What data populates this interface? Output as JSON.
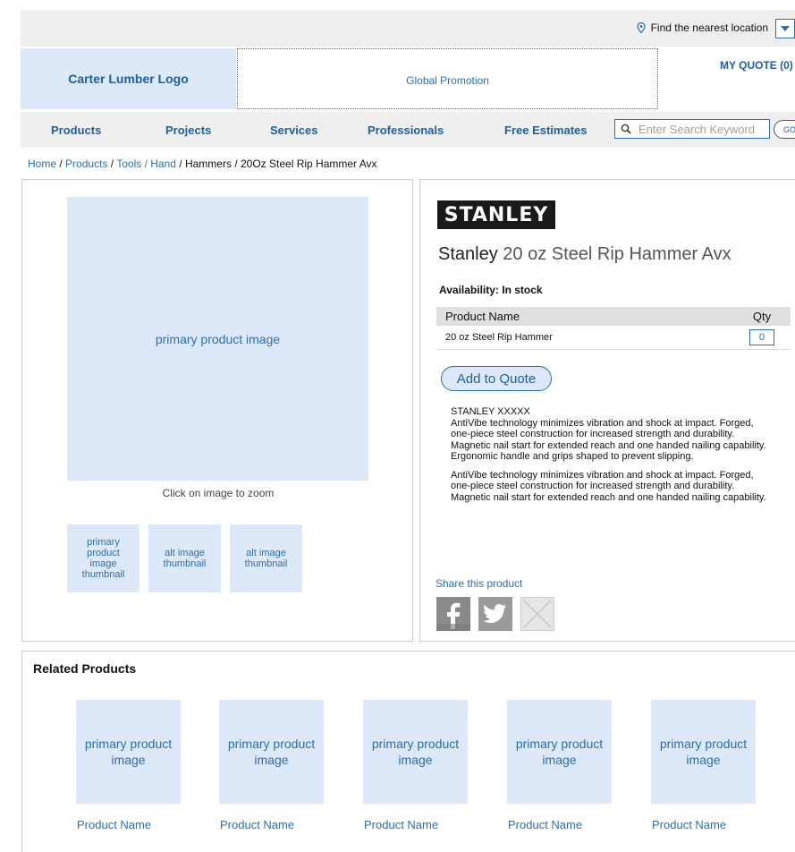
{
  "header": {
    "find_location": "Find the nearest location",
    "logo_text": "Carter Lumber Logo",
    "promotion": "Global Promotion",
    "my_quote": "MY QUOTE (0)"
  },
  "nav": {
    "items": [
      "Products",
      "Projects",
      "Services",
      "Professionals",
      "Free Estimates"
    ],
    "search_placeholder": "Enter Search Keyword",
    "go_label": "GO"
  },
  "breadcrumb": {
    "home": "Home",
    "sep": "/",
    "products": "Products",
    "tools_hand": "Tools / Hand",
    "hammers": "Hammers",
    "current": "20Oz Steel Rip Hammer Avx"
  },
  "gallery": {
    "primary_image": "primary product image",
    "zoom_note": "Click on image to zoom",
    "thumbnails": [
      "primary product image thumbnail",
      "alt image thumbnail",
      "alt image thumbnail"
    ]
  },
  "product": {
    "brand_logo": "STANLEY",
    "brand": "Stanley",
    "title_rest": "20 oz Steel Rip Hammer Avx",
    "availability": "Availability: In stock",
    "table_headers": [
      "Product Name",
      "Qty"
    ],
    "rows": [
      {
        "name": "20 oz Steel Rip Hammer",
        "qty": "0"
      }
    ],
    "add_to_quote": "Add to Quote",
    "desc_heading": "STANLEY XXXXX",
    "desc_p1": "AntiVibe technology minimizes vibration and shock at impact. Forged, one-piece steel construction for increased strength and durability. Magnetic nail start for extended reach and one handed nailing capability. Ergonomic handle and grips shaped to prevent slipping.",
    "desc_p2": "AntiVibe technology minimizes vibration and shock at impact. Forged, one-piece steel construction for increased strength and durability. Magnetic nail start for extended reach and one handed nailing capability.",
    "share_label": "Share this product",
    "share_icons": [
      "facebook-icon",
      "twitter-icon",
      "email-icon"
    ]
  },
  "related": {
    "title": "Related Products",
    "items": [
      {
        "image": "primary product image",
        "name": "Product Name"
      },
      {
        "image": "primary product image",
        "name": "Product Name"
      },
      {
        "image": "primary product image",
        "name": "Product Name"
      },
      {
        "image": "primary product image",
        "name": "Product Name"
      },
      {
        "image": "primary product image",
        "name": "Product Name"
      }
    ]
  },
  "colors": {
    "link": "#2a6fb0",
    "placeholder_fill": "#dde8f8",
    "bar_bg": "#efefef"
  }
}
